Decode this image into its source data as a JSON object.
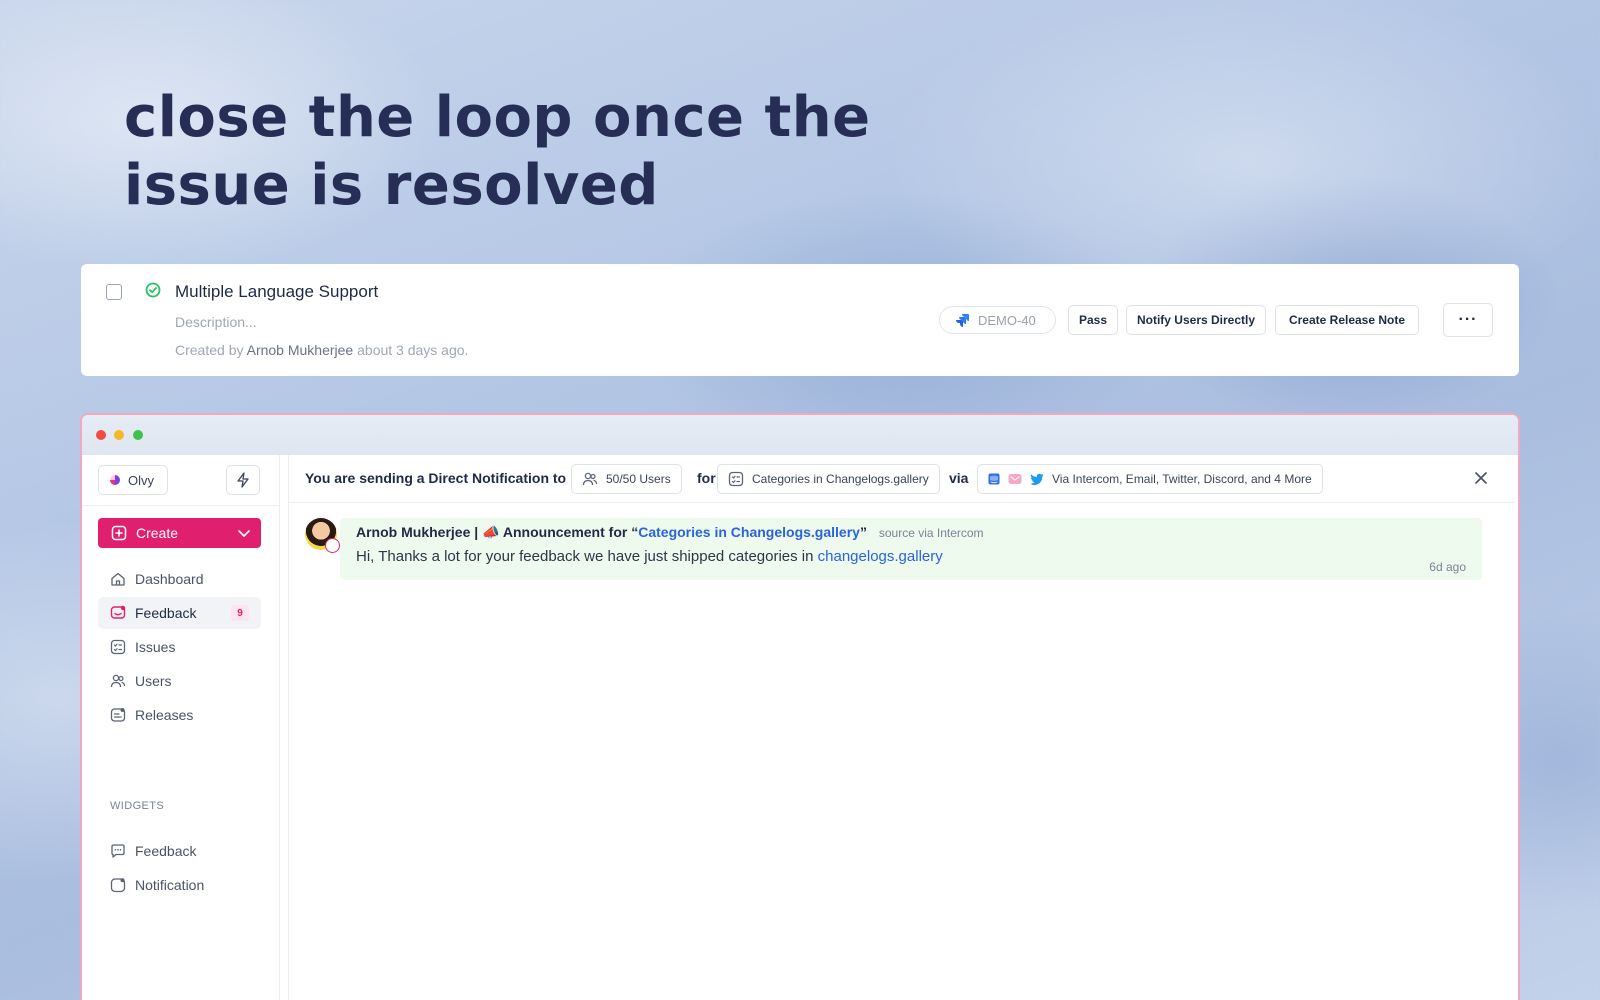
{
  "hero": {
    "line1": "close the loop once the",
    "line2": "issue is resolved"
  },
  "issue_card": {
    "title": "Multiple Language Support",
    "description": "Description...",
    "created_prefix": "Created by",
    "author": "Arnob Mukherjee",
    "created_suffix": "about 3 days ago.",
    "ticket_id": "DEMO-40",
    "buttons": {
      "pass": "Pass",
      "notify": "Notify Users Directly",
      "release": "Create Release Note",
      "more": "···"
    }
  },
  "sidebar": {
    "workspace": "Olvy",
    "create_label": "Create",
    "nav": [
      {
        "label": "Dashboard"
      },
      {
        "label": "Feedback",
        "badge": "9"
      },
      {
        "label": "Issues"
      },
      {
        "label": "Users"
      },
      {
        "label": "Releases"
      }
    ],
    "widgets_heading": "WIDGETS",
    "widgets": [
      {
        "label": "Feedback"
      },
      {
        "label": "Notification"
      }
    ]
  },
  "notification_bar": {
    "lead": "You are sending a Direct Notification to",
    "users_chip": "50/50 Users",
    "for_word": "for",
    "category_chip": "Categories in Changelogs.gallery",
    "via_word": "via",
    "channels_chip": "Via Intercom, Email, Twitter, Discord, and 4 More"
  },
  "message": {
    "author": "Arnob Mukherjee",
    "separator": "|",
    "emoji": "📣",
    "announce_prefix": "Announcement for “",
    "announce_link": "Categories in Changelogs.gallery",
    "announce_suffix": "”",
    "source": "source via Intercom",
    "body_prefix": "Hi, Thanks a lot for your feedback we have just shipped categories in",
    "body_link": "changelogs.gallery",
    "time": "6d ago"
  },
  "colors": {
    "accent": "#e0206e",
    "link": "#2b63d9",
    "success": "#22c55e",
    "heading": "#262e55"
  }
}
